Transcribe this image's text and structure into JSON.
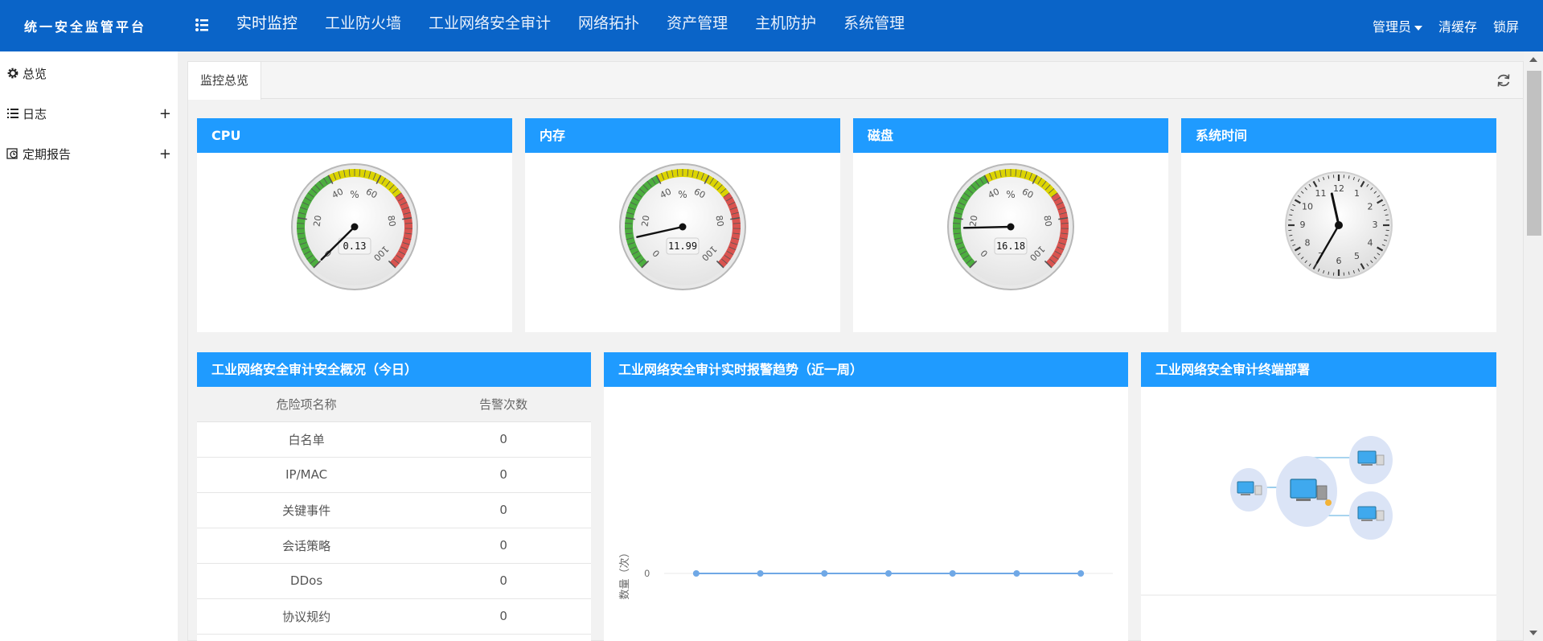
{
  "app": {
    "title": "统一安全监管平台"
  },
  "nav": [
    {
      "label": "实时监控",
      "active": true
    },
    {
      "label": "工业防火墙"
    },
    {
      "label": "工业网络安全审计"
    },
    {
      "label": "网络拓扑"
    },
    {
      "label": "资产管理"
    },
    {
      "label": "主机防护"
    },
    {
      "label": "系统管理"
    }
  ],
  "user_menu": {
    "admin": "管理员",
    "clear_cache": "清缓存",
    "lock": "锁屏"
  },
  "sidebar": [
    {
      "label": "总览",
      "icon": "gear-icon",
      "expandable": false
    },
    {
      "label": "日志",
      "icon": "list-icon",
      "expandable": true,
      "toggle": "+"
    },
    {
      "label": "定期报告",
      "icon": "report-icon",
      "expandable": true,
      "toggle": "+"
    }
  ],
  "tab": {
    "label": "监控总览"
  },
  "gauges": [
    {
      "title": "CPU",
      "value": 0.13,
      "display": "0.13",
      "unit": "%",
      "ticks": [
        "0",
        "20",
        "40",
        "60",
        "80",
        "100"
      ]
    },
    {
      "title": "内存",
      "value": 11.99,
      "display": "11.99",
      "unit": "%",
      "ticks": [
        "0",
        "20",
        "40",
        "60",
        "80",
        "100"
      ]
    },
    {
      "title": "磁盘",
      "value": 16.18,
      "display": "16.18",
      "unit": "%",
      "ticks": [
        "0",
        "20",
        "40",
        "60",
        "80",
        "100"
      ]
    }
  ],
  "clock": {
    "title": "系统时间",
    "hour": 11,
    "minute": 35,
    "second": 0,
    "numbers": [
      "12",
      "1",
      "2",
      "3",
      "4",
      "5",
      "6",
      "7",
      "8",
      "9",
      "10",
      "11"
    ]
  },
  "audit": {
    "title": "工业网络安全审计安全概况（今日）",
    "headers": [
      "危险项名称",
      "告警次数"
    ],
    "rows": [
      [
        "白名单",
        "0"
      ],
      [
        "IP/MAC",
        "0"
      ],
      [
        "关键事件",
        "0"
      ],
      [
        "会话策略",
        "0"
      ],
      [
        "DDos",
        "0"
      ],
      [
        "协议规约",
        "0"
      ]
    ]
  },
  "trend": {
    "title": "工业网络安全审计实时报警趋势（近一周）",
    "chart_data": {
      "type": "line",
      "ylabel": "数量（次）",
      "y_ticks": [
        "0"
      ],
      "values": [
        0,
        0,
        0,
        0,
        0,
        0,
        0
      ],
      "color": "#6fa8e6",
      "grid": true
    }
  },
  "terminal": {
    "title": "工业网络安全审计终端部署"
  },
  "colors": {
    "brand": "#0a64c8",
    "panel_head": "#1f9bff",
    "green": "#4cae3f",
    "yellow": "#dcd400",
    "red": "#d9534f"
  }
}
